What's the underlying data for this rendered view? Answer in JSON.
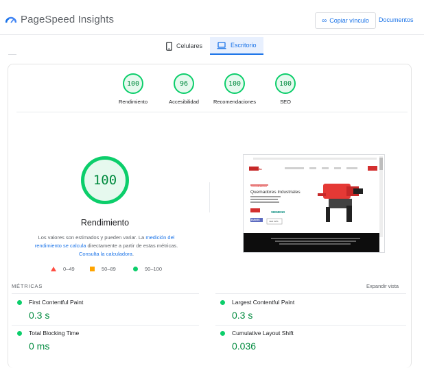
{
  "header": {
    "app_title": "PageSpeed Insights",
    "copy_link_label": "Copiar vínculo",
    "docs_label": "Documentos"
  },
  "tabs": [
    {
      "label": "Celulares",
      "icon": "phone-icon",
      "active": false
    },
    {
      "label": "Escritorio",
      "icon": "laptop-icon",
      "active": true
    }
  ],
  "scores": [
    {
      "value": "100",
      "label": "Rendimiento"
    },
    {
      "value": "96",
      "label": "Accesibilidad"
    },
    {
      "value": "100",
      "label": "Recomendaciones"
    },
    {
      "value": "100",
      "label": "SEO"
    }
  ],
  "performance": {
    "score": "100",
    "label": "Rendimiento",
    "desc_1": "Los valores son estimados y pueden variar. La",
    "desc_link_1": "medición del rendimiento se calcula",
    "desc_2": "directamente a partir de estas métricas.",
    "desc_link_2": "Consulta la calculadora",
    "desc_3": "."
  },
  "legend": {
    "fail": "0–49",
    "average": "50–89",
    "pass": "90–100"
  },
  "screenshot": {
    "hero_small": "Termodinámica",
    "hero_title": "Quemadores Industriales",
    "brand_1": "SIEMENS",
    "brand_2": "DUNGS",
    "cta": "VER MÁS",
    "logo": "TALERMAL"
  },
  "metrics": {
    "title": "MÉTRICAS",
    "expand_label": "Expandir vista",
    "items": [
      {
        "name": "First Contentful Paint",
        "value": "0.3 s"
      },
      {
        "name": "Largest Contentful Paint",
        "value": "0.3 s"
      },
      {
        "name": "Total Blocking Time",
        "value": "0 ms"
      },
      {
        "name": "Cumulative Layout Shift",
        "value": "0.036"
      }
    ]
  },
  "colors": {
    "pass": "#0cce6b",
    "pass_text": "#008a3e",
    "average": "#ffa400",
    "fail": "#ff4e42",
    "link": "#1a73e8"
  }
}
